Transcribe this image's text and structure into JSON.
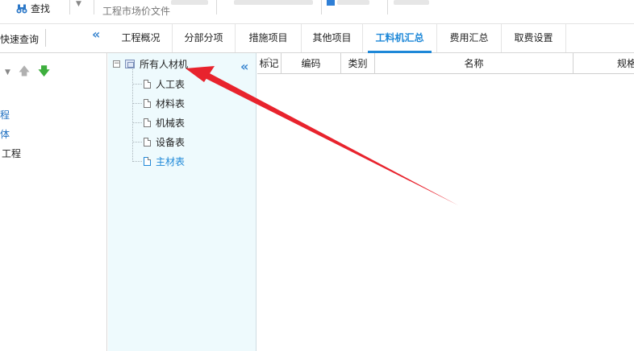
{
  "toolbar": {
    "find_label": "查找",
    "subtitle": "工程市场价文件"
  },
  "quick_query": {
    "label": "快速查询"
  },
  "tabs": [
    {
      "label": "工程概况",
      "active": false
    },
    {
      "label": "分部分项",
      "active": false
    },
    {
      "label": "措施项目",
      "active": false
    },
    {
      "label": "其他项目",
      "active": false
    },
    {
      "label": "工料机汇总",
      "active": true
    },
    {
      "label": "费用汇总",
      "active": false
    },
    {
      "label": "取费设置",
      "active": false
    }
  ],
  "left_nav": {
    "items": [
      "程",
      "体",
      "工程"
    ]
  },
  "tree": {
    "root_label": "所有人材机",
    "children": [
      "人工表",
      "材料表",
      "机械表",
      "设备表",
      "主材表"
    ],
    "selected_index": 4
  },
  "grid": {
    "columns": [
      "标记",
      "编码",
      "类别",
      "名称",
      "规格"
    ]
  },
  "colors": {
    "accent": "#1e88d8",
    "tree_bg": "#eefafd",
    "annotation_arrow": "#e8232d"
  },
  "icons": {
    "find": "binoculars-icon",
    "collapse": "double-chevron-left-icon",
    "move_up": "arrow-up-icon",
    "move_down": "arrow-down-icon",
    "document": "document-icon",
    "tree_root": "folder-grid-icon"
  }
}
